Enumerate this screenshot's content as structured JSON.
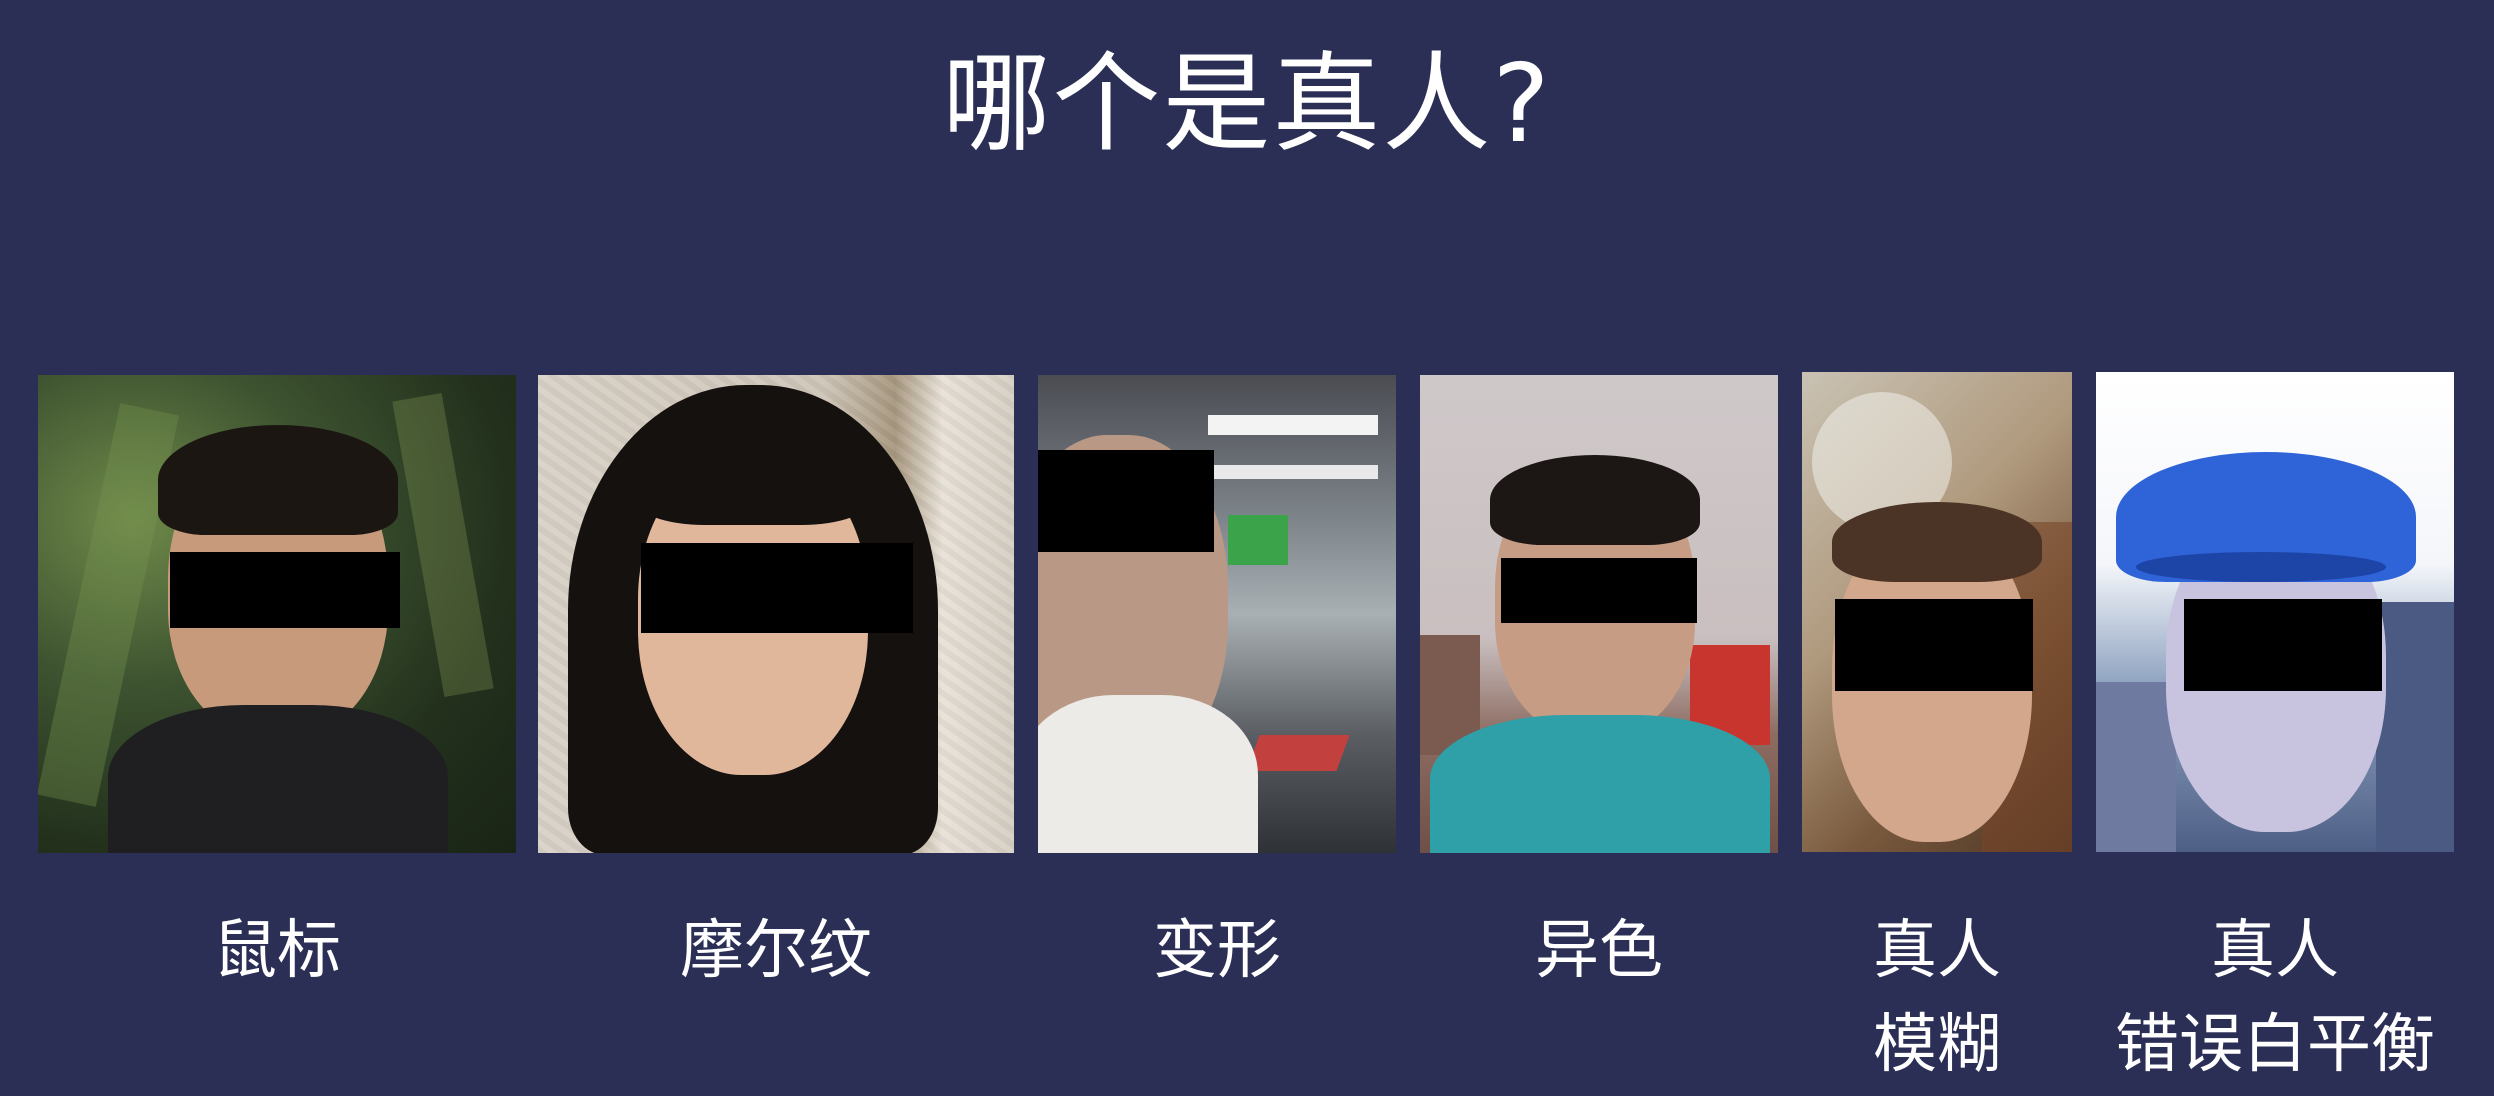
{
  "slide": {
    "title": "哪个是真人?"
  },
  "photos": [
    {
      "caption_lines": [
        "鼠标"
      ]
    },
    {
      "caption_lines": [
        "摩尔纹"
      ]
    },
    {
      "caption_lines": [
        "变形"
      ]
    },
    {
      "caption_lines": [
        "异色"
      ]
    },
    {
      "caption_lines": [
        "真人",
        "模糊"
      ]
    },
    {
      "caption_lines": [
        "真人",
        "错误白平衡"
      ]
    }
  ],
  "colors": {
    "background": "#2b2f55",
    "text": "#ffffff",
    "censor_bar": "#000000"
  }
}
